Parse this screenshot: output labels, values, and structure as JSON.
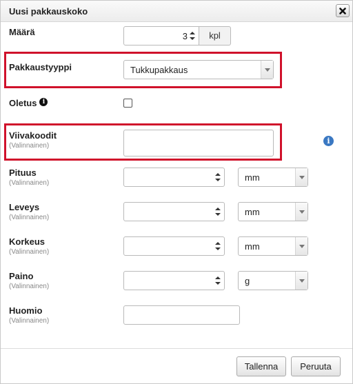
{
  "dialog": {
    "title": "Uusi pakkauskoko",
    "close_icon": "close-icon"
  },
  "fields": {
    "maara": {
      "label": "Määrä",
      "value": "3",
      "unit": "kpl"
    },
    "pakkaustyyppi": {
      "label": "Pakkaustyyppi",
      "value": "Tukkupakkaus"
    },
    "oletus": {
      "label": "Oletus",
      "checked": false
    },
    "viivakoodit": {
      "label": "Viivakoodit",
      "sublabel": "(Valinnainen)",
      "value": ""
    },
    "pituus": {
      "label": "Pituus",
      "sublabel": "(Valinnainen)",
      "value": "",
      "unit": "mm"
    },
    "leveys": {
      "label": "Leveys",
      "sublabel": "(Valinnainen)",
      "value": "",
      "unit": "mm"
    },
    "korkeus": {
      "label": "Korkeus",
      "sublabel": "(Valinnainen)",
      "value": "",
      "unit": "mm"
    },
    "paino": {
      "label": "Paino",
      "sublabel": "(Valinnainen)",
      "value": "",
      "unit": "g"
    },
    "huomio": {
      "label": "Huomio",
      "sublabel": "(Valinnainen)",
      "value": ""
    }
  },
  "footer": {
    "save_label": "Tallenna",
    "cancel_label": "Peruuta"
  },
  "colors": {
    "highlight": "#d0112b",
    "info_blue": "#3a78c2"
  }
}
